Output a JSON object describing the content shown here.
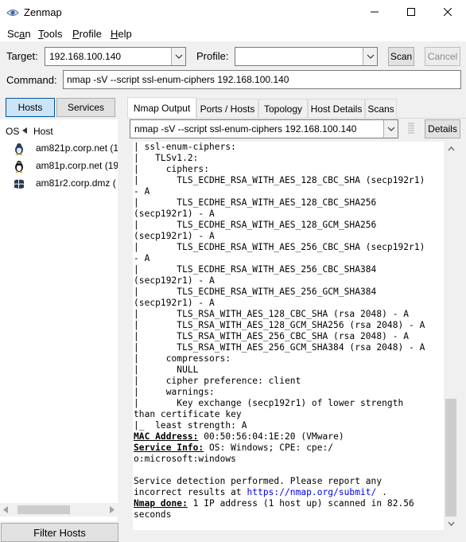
{
  "window": {
    "title": "Zenmap"
  },
  "menu": [
    {
      "pre": "Sc",
      "u": "a",
      "post": "n"
    },
    {
      "pre": "",
      "u": "T",
      "post": "ools"
    },
    {
      "pre": "",
      "u": "P",
      "post": "rofile"
    },
    {
      "pre": "",
      "u": "H",
      "post": "elp"
    }
  ],
  "target": {
    "label": "Target:",
    "value": "192.168.100.140"
  },
  "profile": {
    "label": "Profile:",
    "value": ""
  },
  "scan_button": "Scan",
  "cancel_button": "Cancel",
  "command": {
    "label": "Command:",
    "value": "nmap -sV --script ssl-enum-ciphers 192.168.100.140"
  },
  "view_toggle": {
    "hosts": "Hosts",
    "services": "Services"
  },
  "host_list": {
    "col_os": "OS",
    "col_host": "Host",
    "hosts": [
      {
        "name": "am821p.corp.net (1",
        "os_icon": "linux-penguin-icon"
      },
      {
        "name": "am81p.corp.net (19",
        "os_icon": "linux-penguin-icon"
      },
      {
        "name": "am81r2.corp.dmz (",
        "os_icon": "windows-icon"
      }
    ]
  },
  "filter_hosts_button": "Filter Hosts",
  "tabs": [
    "Nmap Output",
    "Ports / Hosts",
    "Topology",
    "Host Details",
    "Scans"
  ],
  "output_selector": {
    "value": "nmap -sV --script ssl-enum-ciphers 192.168.100.140"
  },
  "details_button": "Details",
  "output_lines": [
    "| ssl-enum-ciphers:",
    "|   TLSv1.2:",
    "|     ciphers:",
    "|       TLS_ECDHE_RSA_WITH_AES_128_CBC_SHA (secp192r1)",
    "- A",
    "|       TLS_ECDHE_RSA_WITH_AES_128_CBC_SHA256",
    "(secp192r1) - A",
    "|       TLS_ECDHE_RSA_WITH_AES_128_GCM_SHA256",
    "(secp192r1) - A",
    "|       TLS_ECDHE_RSA_WITH_AES_256_CBC_SHA (secp192r1)",
    "- A",
    "|       TLS_ECDHE_RSA_WITH_AES_256_CBC_SHA384",
    "(secp192r1) - A",
    "|       TLS_ECDHE_RSA_WITH_AES_256_GCM_SHA384",
    "(secp192r1) - A",
    "|       TLS_RSA_WITH_AES_128_CBC_SHA (rsa 2048) - A",
    "|       TLS_RSA_WITH_AES_128_GCM_SHA256 (rsa 2048) - A",
    "|       TLS_RSA_WITH_AES_256_CBC_SHA (rsa 2048) - A",
    "|       TLS_RSA_WITH_AES_256_GCM_SHA384 (rsa 2048) - A",
    "|     compressors:",
    "|       NULL",
    "|     cipher preference: client",
    "|     warnings:",
    "|       Key exchange (secp192r1) of lower strength",
    "than certificate key",
    "|_  least strength: A"
  ],
  "mac": {
    "label": "MAC Address:",
    "value": " 00:50:56:04:1E:20 (VMware)"
  },
  "service_info": {
    "label": "Service Info:",
    "value": " OS: Windows; CPE: cpe:/",
    "cont": "o:microsoft:windows"
  },
  "detection": {
    "line1": "Service detection performed. Please report any",
    "line2_pre": "incorrect results at ",
    "line2_link": "https://nmap.org/submit/",
    "line2_post": " ."
  },
  "done": {
    "label": "Nmap done:",
    "value": " 1 IP address (1 host up) scanned in 82.56",
    "cont": "seconds"
  }
}
